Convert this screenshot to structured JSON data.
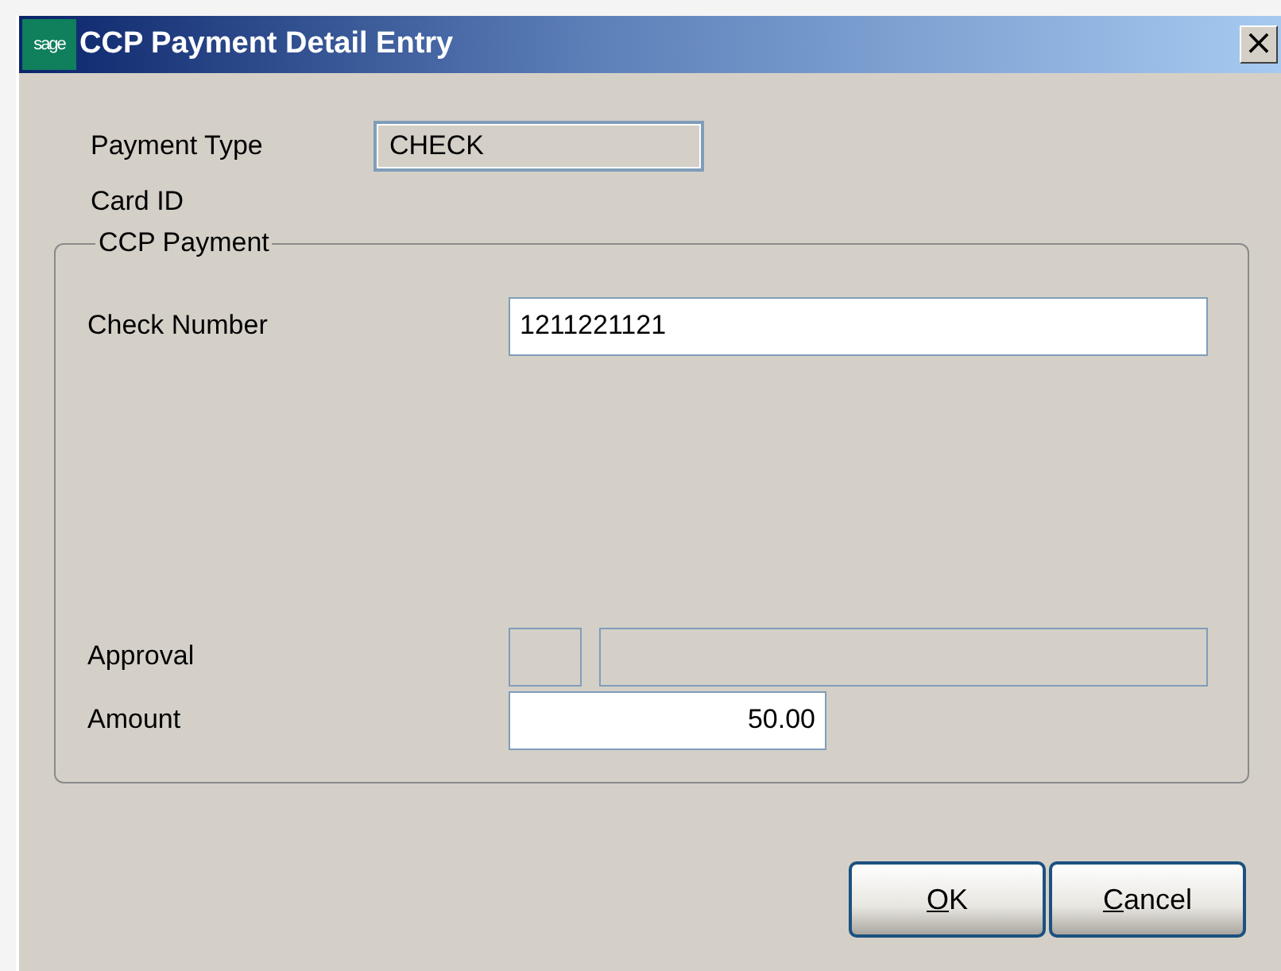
{
  "window": {
    "title": "CCP Payment Detail Entry",
    "logo": "sage",
    "close": "×"
  },
  "header_fields": [
    {
      "label": "Payment Type",
      "value": "CHECK",
      "kind": "readonly"
    },
    {
      "label": "Card ID",
      "kind": "none"
    }
  ],
  "group": {
    "title": "CCP Payment",
    "fields": [
      {
        "label": "Check Number",
        "value": "1211221121",
        "kind": "wide"
      },
      {
        "kind": "spacer"
      },
      {
        "label": "Approval",
        "kind": "approval"
      },
      {
        "label": "Amount",
        "value": "50.00",
        "kind": "amount"
      }
    ]
  },
  "buttons": [
    {
      "label": "OK",
      "mnemonic": true
    },
    {
      "label": "Cancel",
      "mnemonic": true
    }
  ]
}
